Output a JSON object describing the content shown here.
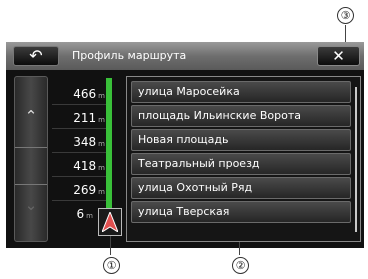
{
  "callouts": {
    "c1": "①",
    "c2": "②",
    "c3": "③"
  },
  "header": {
    "back_icon": "↶",
    "title": "Профиль маршрута",
    "close_icon": "✕"
  },
  "scroll": {
    "up_icon": "⌃",
    "down_icon": "⌄"
  },
  "rows": [
    {
      "distance": "466",
      "unit": "m",
      "street": "улица Маросейка"
    },
    {
      "distance": "211",
      "unit": "m",
      "street": "площадь Ильинские Ворота"
    },
    {
      "distance": "348",
      "unit": "m",
      "street": "Новая площадь"
    },
    {
      "distance": "418",
      "unit": "m",
      "street": "Театральный проезд"
    },
    {
      "distance": "269",
      "unit": "m",
      "street": "улица Охотный Ряд"
    },
    {
      "distance": "6",
      "unit": "m",
      "street": "улица Тверская"
    }
  ],
  "colors": {
    "route": "#39c039",
    "arrow": "#e05050"
  }
}
